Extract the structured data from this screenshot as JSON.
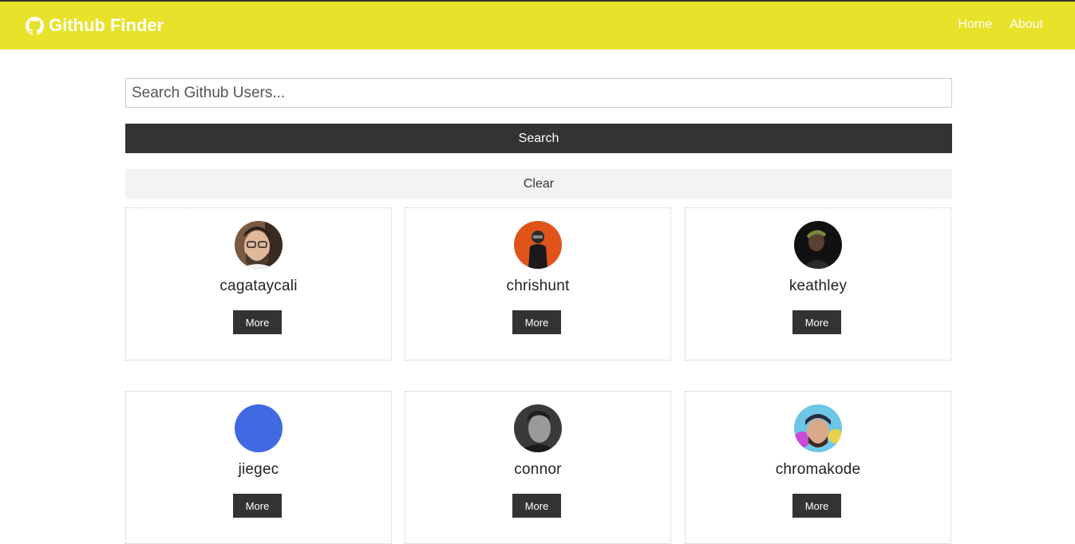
{
  "navbar": {
    "brand": "Github Finder",
    "brand_icon": "github-icon",
    "links": [
      {
        "label": "Home"
      },
      {
        "label": "About"
      }
    ]
  },
  "search": {
    "placeholder": "Search Github Users...",
    "value": "",
    "search_label": "Search",
    "clear_label": "Clear"
  },
  "users": [
    {
      "login": "cagataycali",
      "more_label": "More"
    },
    {
      "login": "chrishunt",
      "more_label": "More"
    },
    {
      "login": "keathley",
      "more_label": "More"
    },
    {
      "login": "jiegec",
      "more_label": "More"
    },
    {
      "login": "connor",
      "more_label": "More"
    },
    {
      "login": "chromakode",
      "more_label": "More"
    }
  ],
  "colors": {
    "navbar": "#e8e22a",
    "dark": "#333333",
    "light": "#f3f3f3"
  }
}
